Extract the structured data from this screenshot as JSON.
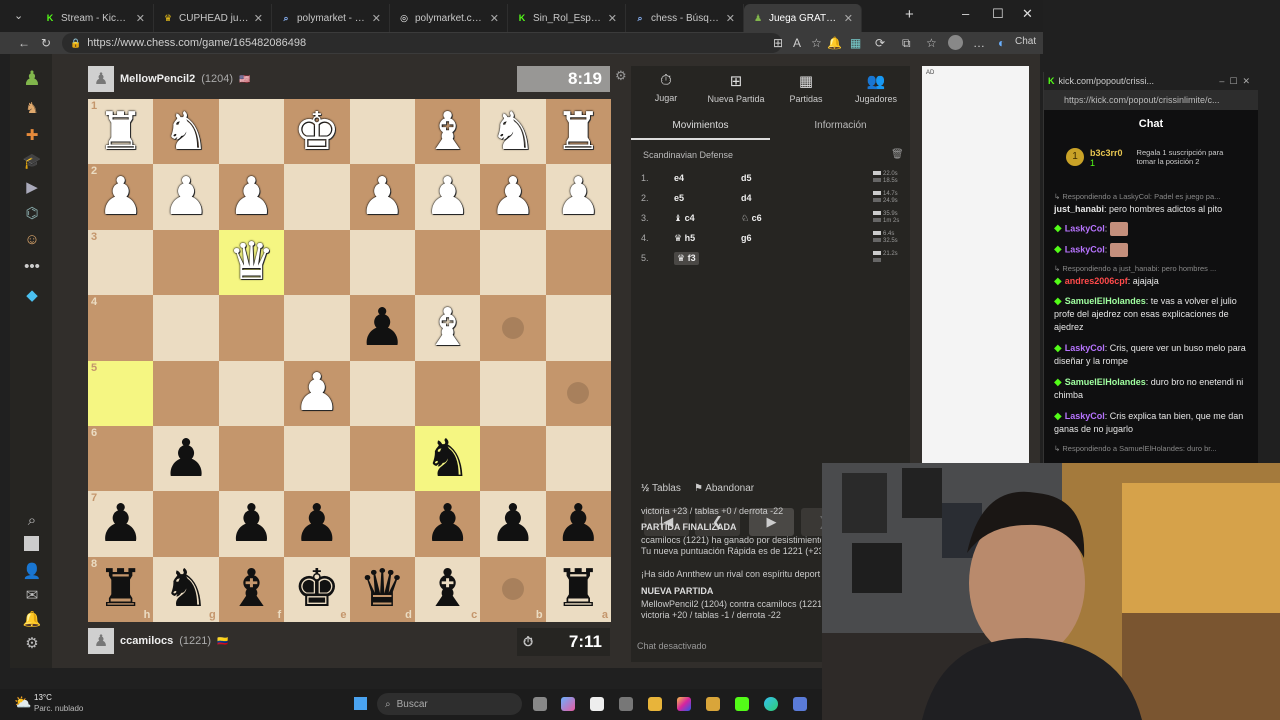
{
  "tabs": [
    {
      "title": "Stream - Kick Dashb",
      "icon": "K",
      "color": "#53fc18"
    },
    {
      "title": "CUPHEAD juego gratis c",
      "icon": "♛",
      "color": "#f0c419"
    },
    {
      "title": "polymarket - Búsqueda",
      "icon": "⌕",
      "color": "#8ab4f8"
    },
    {
      "title": "polymarket.com",
      "icon": "◎",
      "color": "#ffffff"
    },
    {
      "title": "Sin_Rol_Especifico Strea",
      "icon": "K",
      "color": "#53fc18"
    },
    {
      "title": "chess - Búsqueda",
      "icon": "⌕",
      "color": "#8ab4f8"
    },
    {
      "title": "Juega GRATIS al ajedrez",
      "icon": "♟",
      "color": "#81b64c"
    }
  ],
  "browser": {
    "url": "https://www.chess.com/game/165482086498",
    "copilot_label": "Chat"
  },
  "game": {
    "top_player": {
      "name": "MellowPencil2",
      "rating": "(1204)",
      "flag": "🇺🇸",
      "clock": "8:19"
    },
    "bottom_player": {
      "name": "ccamilocs",
      "rating": "(1221)",
      "flag": "🇨🇴",
      "clock": "7:11"
    },
    "rank_labels": [
      "1",
      "2",
      "3",
      "4",
      "5",
      "6",
      "7",
      "8"
    ],
    "file_labels": [
      "h",
      "g",
      "f",
      "e",
      "d",
      "c",
      "b",
      "a"
    ],
    "board": [
      [
        "wR",
        "wN",
        "",
        "wK",
        "",
        "wB",
        "wN",
        "wR"
      ],
      [
        "wP",
        "wP",
        "wP",
        "",
        "wP",
        "wP",
        "wP",
        "wP"
      ],
      [
        "",
        "",
        "wQ",
        "",
        "",
        "",
        "",
        ""
      ],
      [
        "",
        "",
        "",
        "",
        "bP",
        "wB",
        "",
        ""
      ],
      [
        "",
        "",
        "",
        "wP",
        "",
        "",
        "",
        ""
      ],
      [
        "",
        "bP",
        "",
        "",
        "",
        "bN",
        "",
        ""
      ],
      [
        "bP",
        "",
        "bP",
        "bP",
        "",
        "bP",
        "bP",
        "bP"
      ],
      [
        "bR",
        "bN",
        "bB",
        "bK",
        "bQ",
        "bB",
        "",
        "bR"
      ]
    ]
  },
  "panel": {
    "nav": [
      {
        "label": "Jugar",
        "icon": "⏱"
      },
      {
        "label": "Nueva Partida",
        "icon": "⊞"
      },
      {
        "label": "Partidas",
        "icon": "▦"
      },
      {
        "label": "Jugadores",
        "icon": "👥"
      }
    ],
    "subtabs": [
      "Movimientos",
      "Información"
    ],
    "opening": "Scandinavian Defense",
    "moves": [
      {
        "n": "1.",
        "w": "e4",
        "b": "d5",
        "tw": "22.0s",
        "tb": "18.5s"
      },
      {
        "n": "2.",
        "w": "e5",
        "b": "d4",
        "tw": "14.7s",
        "tb": "24.9s"
      },
      {
        "n": "3.",
        "w": "♝ c4",
        "b": "♘ c6",
        "tw": "35.9s",
        "tb": "1m 2s"
      },
      {
        "n": "4.",
        "w": "♛ h5",
        "b": "g6",
        "tw": "6.4s",
        "tb": "32.5s"
      },
      {
        "n": "5.",
        "w": "♛ f3",
        "b": "",
        "tw": "21.2s",
        "tb": ""
      }
    ],
    "draw_label": "Tablas",
    "resign_label": "Abandonar",
    "chat": [
      "victoria +23 / tablas +0 / derrota -22",
      "PARTIDA FINALIZADA",
      "ccamilocs (1221) ha ganado por desistimiento",
      "Tu nueva puntuación Rápida es de 1221 (+23).",
      "¡Ha sido Annthew un rival con espíritu deport",
      "NUEVA PARTIDA",
      "MellowPencil2 (1204) contra ccamilocs (1221)",
      "victoria +20 / tablas -1 / derrota -22"
    ],
    "chat_disabled": "Chat desactivado"
  },
  "ad_label": "AD",
  "kick": {
    "window_title": "kick.com/popout/crissi...",
    "url": "https://kick.com/popout/crissinlimite/c...",
    "chat_title": "Chat",
    "sub_user": "b3c3rr0",
    "sub_count": "1",
    "sub_text": "Regala 1 suscripción para tomar la posición 2",
    "messages": [
      {
        "type": "reply",
        "text": "↳ Respondiendo a LaskyCol: Padel es juego pa..."
      },
      {
        "type": "msg",
        "user": "just_hanabi",
        "color": "#e6e6e6",
        "text": ": pero hombres adictos al pito",
        "gem": false
      },
      {
        "type": "msg",
        "user": "LaskyCol",
        "color": "#b774ff",
        "text": ":",
        "gem": true,
        "emote": true
      },
      {
        "type": "msg",
        "user": "LaskyCol",
        "color": "#b774ff",
        "text": ":",
        "gem": true,
        "emote": true
      },
      {
        "type": "reply",
        "text": "↳ Respondiendo a just_hanabi: pero hombres ..."
      },
      {
        "type": "msg",
        "user": "andres2006cpf",
        "color": "#ff4a4a",
        "text": ": ajajaja",
        "gem": true
      },
      {
        "type": "msg",
        "user": "SamuelElHolandes",
        "color": "#a0ffa0",
        "text": ": te vas a volver el julio profe del ajedrez con esas explicaciones de ajedrez",
        "gem": true
      },
      {
        "type": "msg",
        "user": "LaskyCol",
        "color": "#b774ff",
        "text": ": Cris, quere ver un buso melo para diseñar y la rompe",
        "gem": true
      },
      {
        "type": "msg",
        "user": "SamuelElHolandes",
        "color": "#a0ffa0",
        "text": ": duro bro no enetendi ni chimba",
        "gem": true
      },
      {
        "type": "msg",
        "user": "LaskyCol",
        "color": "#b774ff",
        "text": ": Cris explica tan bien, que me dan ganas de no jugarlo",
        "gem": true
      },
      {
        "type": "reply",
        "text": "↳ Respondiendo a SamuelElHolandes: duro br..."
      }
    ]
  },
  "taskbar": {
    "weather_temp": "13°C",
    "weather_desc": "Parc. nublado",
    "search_placeholder": "Buscar"
  }
}
